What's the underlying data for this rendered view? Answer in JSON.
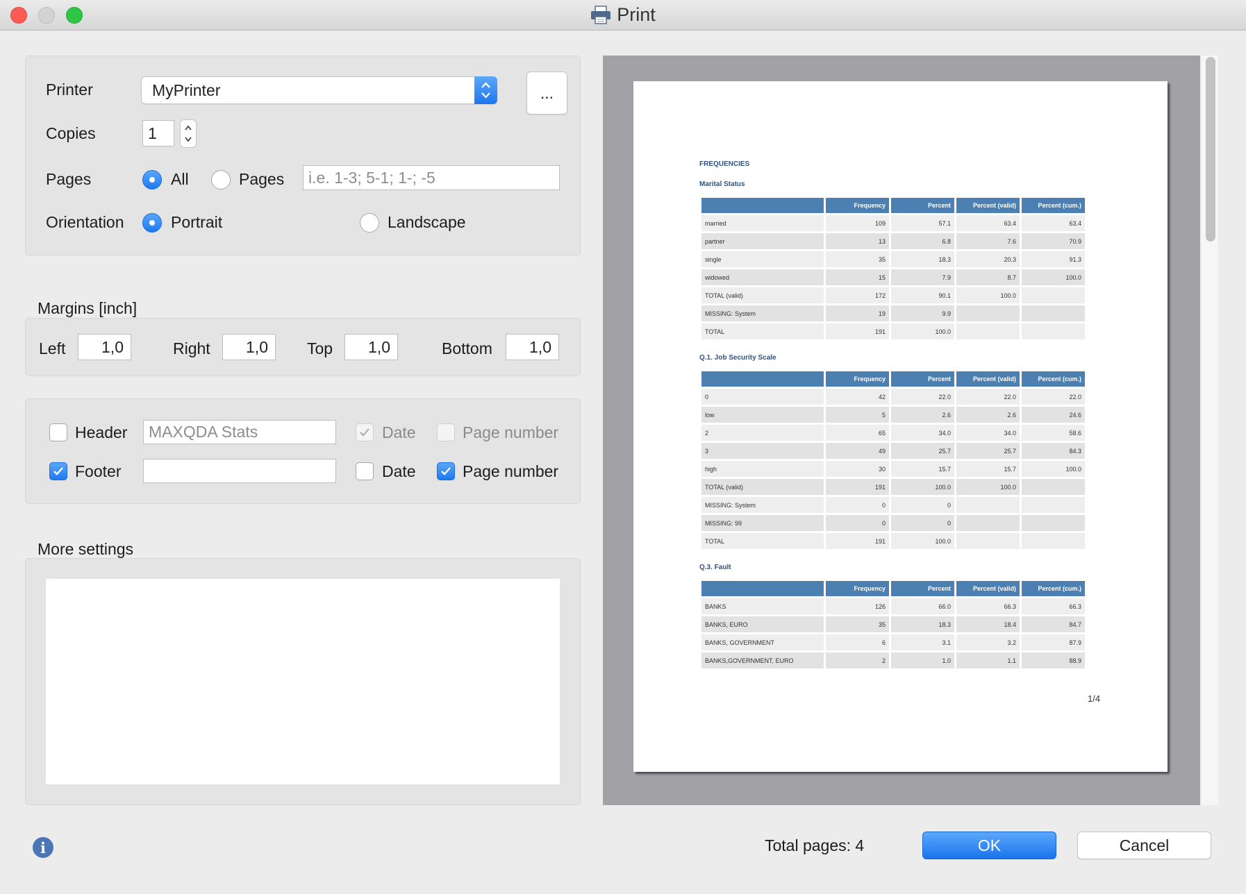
{
  "window": {
    "title": "Print"
  },
  "printer": {
    "label": "Printer",
    "value": "MyPrinter",
    "more_label": "..."
  },
  "copies": {
    "label": "Copies",
    "value": "1"
  },
  "pages": {
    "label": "Pages",
    "all_label": "All",
    "range_label": "Pages",
    "range_placeholder": "i.e. 1-3; 5-1; 1-; -5",
    "selected": "All"
  },
  "orientation": {
    "label": "Orientation",
    "portrait_label": "Portrait",
    "landscape_label": "Landscape",
    "selected": "Portrait"
  },
  "margins": {
    "title": "Margins [inch]",
    "left_label": "Left",
    "left": "1,0",
    "right_label": "Right",
    "right": "1,0",
    "top_label": "Top",
    "top": "1,0",
    "bottom_label": "Bottom",
    "bottom": "1,0"
  },
  "header_footer": {
    "header_label": "Header",
    "header_checked": false,
    "header_text": "MAXQDA Stats",
    "header_date_label": "Date",
    "header_date_checked": true,
    "header_date_enabled": false,
    "header_page_label": "Page number",
    "header_page_checked": false,
    "header_page_enabled": false,
    "footer_label": "Footer",
    "footer_checked": true,
    "footer_text": "",
    "footer_date_label": "Date",
    "footer_date_checked": false,
    "footer_page_label": "Page number",
    "footer_page_checked": true
  },
  "more_settings": {
    "title": "More settings"
  },
  "preview": {
    "doc_title": "FREQUENCIES",
    "columns": [
      "",
      "Frequency",
      "Percent",
      "Percent (valid)",
      "Percent (cum.)"
    ],
    "tables": [
      {
        "title": "Marital Status",
        "rows": [
          [
            "married",
            "109",
            "57.1",
            "63.4",
            "63.4"
          ],
          [
            "partner",
            "13",
            "6.8",
            "7.6",
            "70.9"
          ],
          [
            "single",
            "35",
            "18.3",
            "20.3",
            "91.3"
          ],
          [
            "widowed",
            "15",
            "7.9",
            "8.7",
            "100.0"
          ],
          [
            "TOTAL (valid)",
            "172",
            "90.1",
            "100.0",
            ""
          ],
          [
            "MISSING: System",
            "19",
            "9.9",
            "",
            ""
          ],
          [
            "TOTAL",
            "191",
            "100.0",
            "",
            ""
          ]
        ]
      },
      {
        "title": "Q.1. Job Security Scale",
        "rows": [
          [
            "0",
            "42",
            "22.0",
            "22.0",
            "22.0"
          ],
          [
            "low",
            "5",
            "2.6",
            "2.6",
            "24.6"
          ],
          [
            "2",
            "65",
            "34.0",
            "34.0",
            "58.6"
          ],
          [
            "3",
            "49",
            "25.7",
            "25.7",
            "84.3"
          ],
          [
            "high",
            "30",
            "15.7",
            "15.7",
            "100.0"
          ],
          [
            "TOTAL (valid)",
            "191",
            "100.0",
            "100.0",
            ""
          ],
          [
            "MISSING: System",
            "0",
            "0",
            "",
            ""
          ],
          [
            "MISSING: 99",
            "0",
            "0",
            "",
            ""
          ],
          [
            "TOTAL",
            "191",
            "100.0",
            "",
            ""
          ]
        ]
      },
      {
        "title": "Q.3. Fault",
        "rows": [
          [
            "BANKS",
            "126",
            "66.0",
            "66.3",
            "66.3"
          ],
          [
            "BANKS, EURO",
            "35",
            "18.3",
            "18.4",
            "84.7"
          ],
          [
            "BANKS, GOVERNMENT",
            "6",
            "3.1",
            "3.2",
            "87.9"
          ],
          [
            "BANKS,GOVERNMENT, EURO",
            "2",
            "1.0",
            "1.1",
            "88.9"
          ]
        ]
      }
    ],
    "page_indicator": "1/4"
  },
  "footer": {
    "total_pages": "Total pages: 4",
    "ok_label": "OK",
    "cancel_label": "Cancel"
  }
}
